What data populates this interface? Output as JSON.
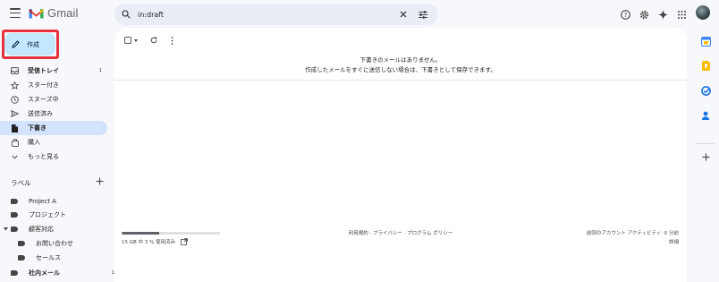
{
  "app": {
    "logo_text": "Gmail",
    "brand_colors": {
      "red": "#ea4335",
      "blue": "#4285f4",
      "green": "#34a853",
      "yellow": "#fbbc04"
    }
  },
  "search": {
    "value": "in:draft",
    "icons": [
      "search-icon",
      "clear-icon",
      "search-options-icon"
    ]
  },
  "header_icons": [
    "help-icon",
    "settings-icon",
    "gemini-icon",
    "apps-grid-icon",
    "account-avatar"
  ],
  "compose": {
    "label": "作成",
    "icon": "pencil-icon",
    "highlight_color": "#e5333d"
  },
  "nav": {
    "items": [
      {
        "label": "受信トレイ",
        "icon": "inbox-icon",
        "count": "1",
        "bold": true
      },
      {
        "label": "スター付き",
        "icon": "star-icon"
      },
      {
        "label": "スヌーズ中",
        "icon": "clock-icon"
      },
      {
        "label": "送信済み",
        "icon": "send-icon"
      },
      {
        "label": "下書き",
        "icon": "draft-icon",
        "active": true
      },
      {
        "label": "購入",
        "icon": "shopping-bag-icon"
      },
      {
        "label": "もっと見る",
        "icon": "chevron-down-icon"
      }
    ]
  },
  "labels": {
    "title": "ラベル",
    "add_icon": "plus-icon",
    "items": [
      {
        "label": "Project A"
      },
      {
        "label": "プロジェクト"
      },
      {
        "label": "顧客対応",
        "expanded": true
      },
      {
        "label": "お問い合わせ",
        "nested": true
      },
      {
        "label": "セールス",
        "nested": true
      },
      {
        "label": "社内メール",
        "count": "1",
        "bold": true
      }
    ]
  },
  "toolbar": {
    "icons": [
      "select-checkbox-icon",
      "select-dropdown-icon",
      "refresh-icon",
      "more-vert-icon"
    ]
  },
  "empty_state": {
    "line1": "下書きのメールはありません。",
    "line2": "作成したメールをすぐに送信しない場合は、下書きとして保存できます。"
  },
  "footer": {
    "storage_used_fraction": 0.38,
    "storage_text": "15 GB 中 3 % 使用済み",
    "links": "利用規約 · プライバシー · プログラム ポリシー",
    "last_activity": "前回のアカウント アクティビティ: 0 分前",
    "details": "詳細"
  },
  "right_rail": {
    "icons": [
      "calendar-icon",
      "keep-icon",
      "tasks-icon",
      "contacts-icon",
      "add-addon-icon"
    ]
  }
}
